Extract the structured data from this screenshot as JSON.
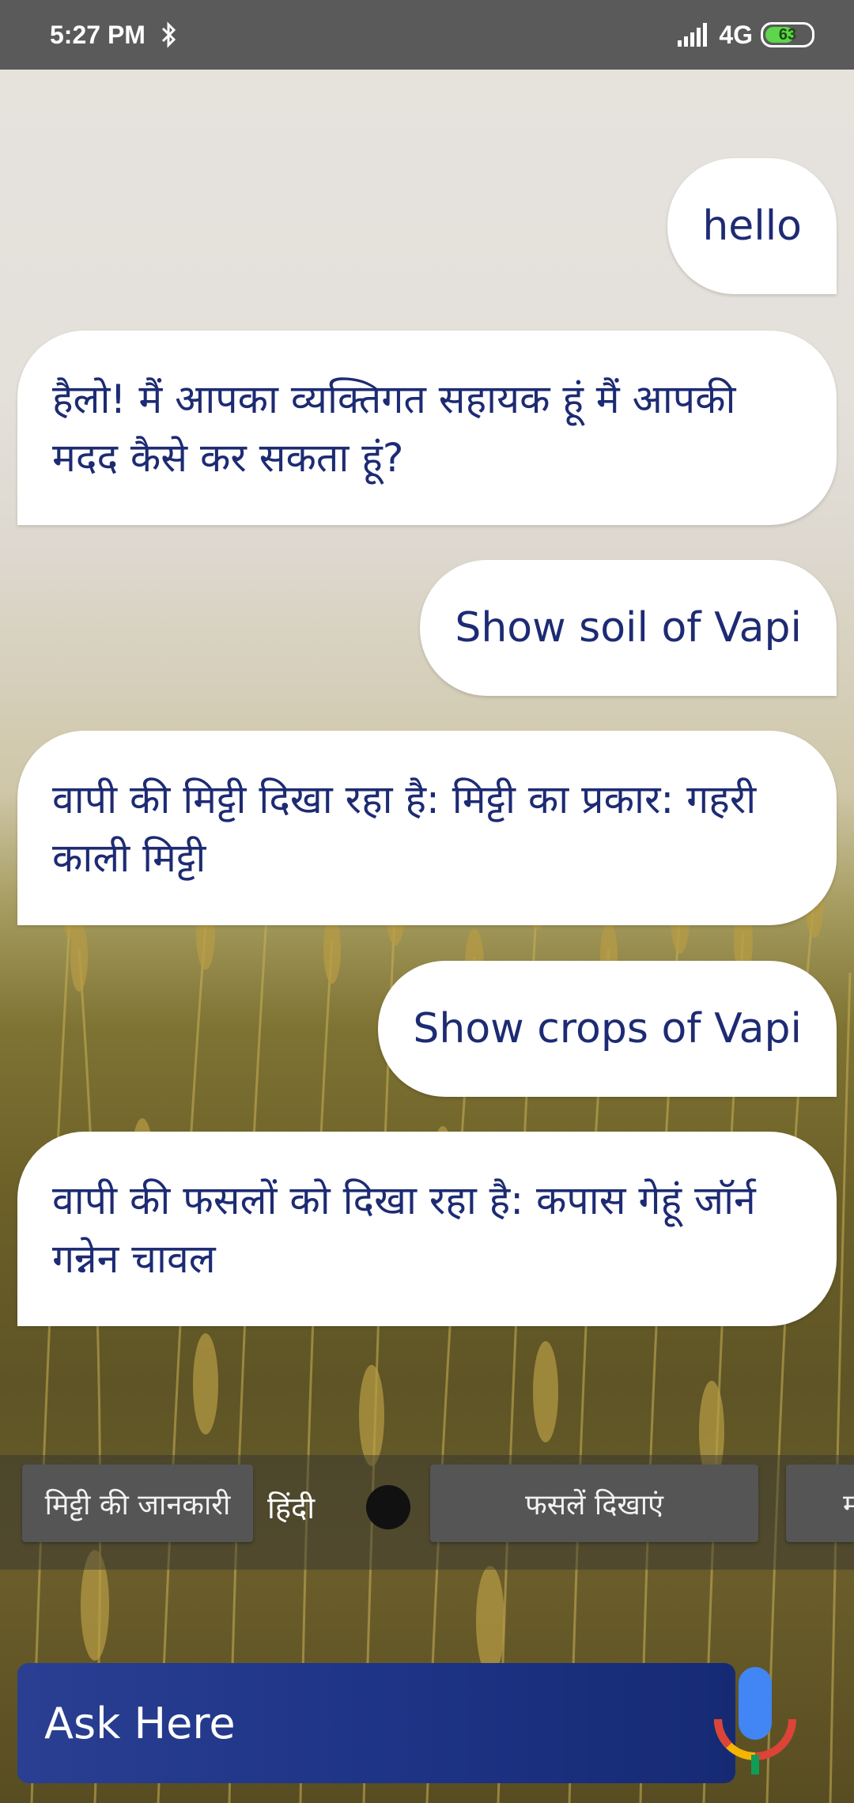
{
  "status_bar": {
    "time": "5:27 PM",
    "bluetooth_icon": "bluetooth-icon",
    "signal_icon": "signal-icon",
    "network": "4G",
    "battery": "63"
  },
  "chat": {
    "messages": [
      {
        "from": "user",
        "text": "hello"
      },
      {
        "from": "bot",
        "text": "हैलो! मैं आपका व्यक्तिगत सहायक हूं मैं आपकी मदद कैसे कर सकता हूं?"
      },
      {
        "from": "user",
        "text": "Show soil of Vapi"
      },
      {
        "from": "bot",
        "text": "वापी की मिट्टी दिखा रहा है: मिट्टी का प्रकार: गहरी काली मिट्टी"
      },
      {
        "from": "user",
        "text": "Show crops of Vapi"
      },
      {
        "from": "bot",
        "text": "वापी की फसलों को दिखा रहा है: कपास गेहूं जॉर्न गन्नेन चावल"
      }
    ]
  },
  "suggestions": {
    "chip_soil": "मिट्टी की जानकारी",
    "language_label": "हिंदी",
    "chip_crops": "फसलें दिखाएं",
    "chip_partial": "म"
  },
  "input": {
    "placeholder": "Ask Here",
    "mic_icon": "google-mic-icon"
  },
  "colors": {
    "bubble_text": "#1d2b73",
    "ask_bar": "#1e3486",
    "status_bar": "#5a5a5a",
    "chip": "#555555"
  }
}
